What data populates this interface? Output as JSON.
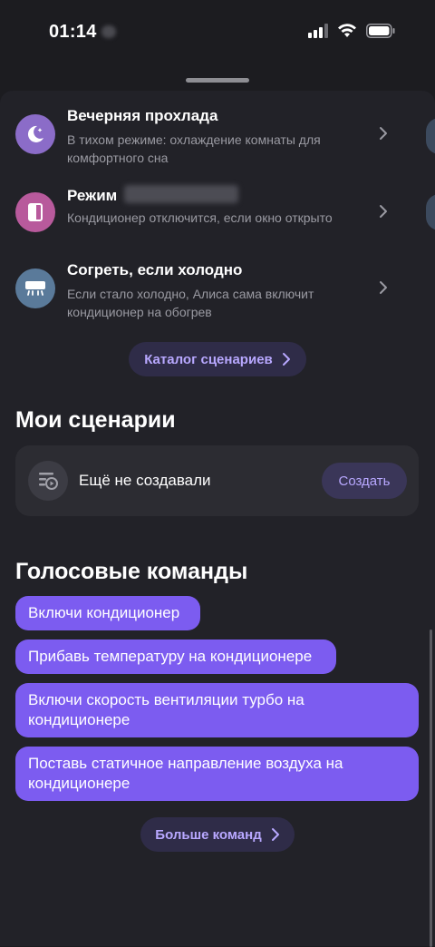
{
  "status_bar": {
    "time": "01:14"
  },
  "scenarios": [
    {
      "title": "Вечерняя прохлада",
      "description": "В тихом режиме: охлаждение комнаты для комфортного сна",
      "icon": "moon-icon",
      "icon_color": "#8b6cc8"
    },
    {
      "title": "Режим",
      "description": "Кондиционер отключится, если окно открыто",
      "icon": "window-icon",
      "icon_color": "#b85a9c"
    },
    {
      "title": "Согреть, если холодно",
      "description": "Если стало холодно, Алиса сама включит кондиционер на обогрев",
      "icon": "air-conditioner-icon",
      "icon_color": "#5a7a9a"
    }
  ],
  "catalog_button": {
    "label": "Каталог сценариев"
  },
  "my_scenarios": {
    "title": "Мои сценарии",
    "empty_label": "Ещё не создавали",
    "create_label": "Создать"
  },
  "voice_commands": {
    "title": "Голосовые команды",
    "items": [
      "Включи кондиционер",
      "Прибавь температуру на кондиционере",
      "Включи скорость вентиляции турбо на кондиционере",
      "Поставь статичное направление воздуха на кондиционере"
    ],
    "more_label": "Больше команд"
  },
  "colors": {
    "background": "#1c1c20",
    "panel": "#222228",
    "accent": "#7c5cf0",
    "accent_text": "#b8a8ff"
  }
}
